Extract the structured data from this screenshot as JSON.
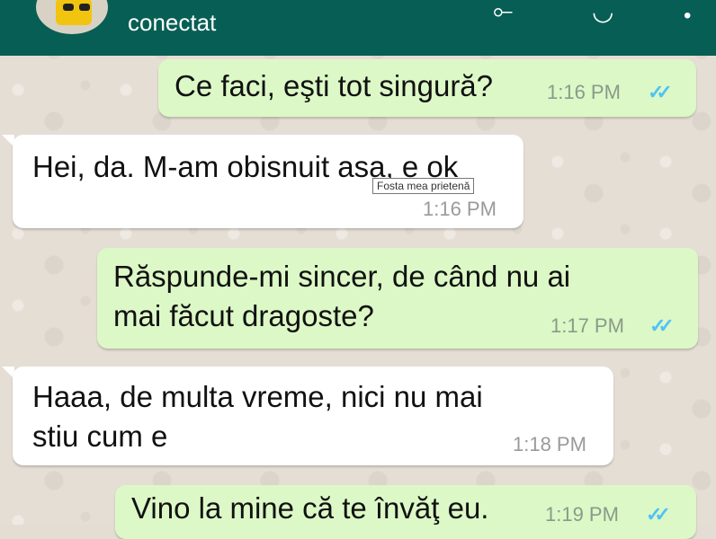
{
  "header": {
    "status": "conectat",
    "icons": [
      "avatar",
      "video-call-icon",
      "call-icon",
      "menu-icon"
    ]
  },
  "messages": [
    {
      "direction": "outgoing",
      "text": "Ce faci, eşti tot singură?",
      "time": "1:16 PM",
      "read": true
    },
    {
      "direction": "incoming",
      "text": "Hei, da. M-am obisnuit asa, e ok",
      "time": "1:16 PM"
    },
    {
      "direction": "outgoing",
      "text_line1": "Răspunde-mi sincer, de când nu ai",
      "text_line2": "mai făcut dragoste?",
      "time": "1:17 PM",
      "read": true
    },
    {
      "direction": "incoming",
      "text_line1": "Haaa, de multa vreme, nici nu mai",
      "text_line2": "stiu cum e",
      "time": "1:18 PM"
    },
    {
      "direction": "outgoing",
      "text": "Vino la mine că te învăţ eu.",
      "time": "1:19 PM",
      "read": true
    }
  ],
  "tooltip": "Fosta mea prietenă",
  "colors": {
    "header": "#075e54",
    "outgoing_bubble": "#dcf8c6",
    "incoming_bubble": "#ffffff",
    "read_ticks": "#4fc3f7"
  }
}
